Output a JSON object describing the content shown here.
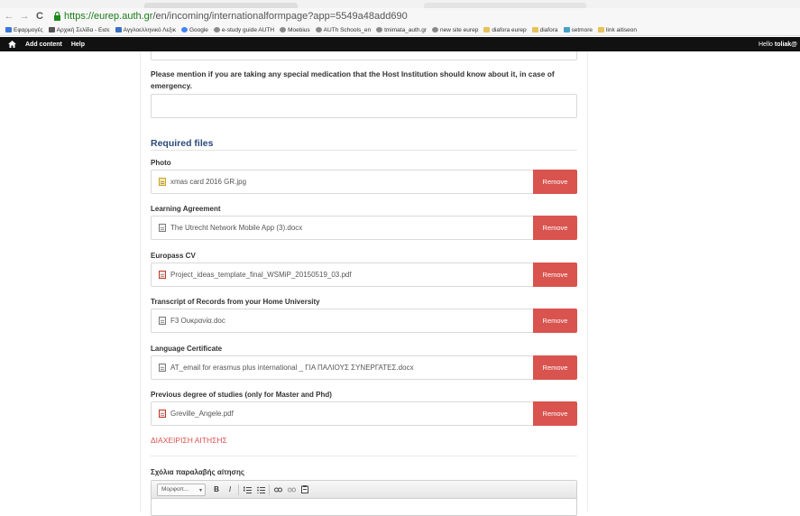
{
  "browser": {
    "url_host": "https://eurep.auth.gr",
    "url_path": "/en/incoming/internationalformpage?app=5549a48add690",
    "bookmarks": [
      {
        "label": "Εφαρμογές",
        "icon": "grid"
      },
      {
        "label": "Αρχική Σελίδα - Εισε",
        "icon": "mail"
      },
      {
        "label": "Αγγλοελληνικό Λεξικ",
        "icon": "blue"
      },
      {
        "label": "Google",
        "icon": "g"
      },
      {
        "label": "e-study guide AUTH",
        "icon": "globe"
      },
      {
        "label": "Moebius",
        "icon": "globe"
      },
      {
        "label": "AUTh Schools_en",
        "icon": "globe"
      },
      {
        "label": "tmimata_auth.gr",
        "icon": "globe"
      },
      {
        "label": "new site eurep",
        "icon": "globe"
      },
      {
        "label": "diafora eurep",
        "icon": "folder"
      },
      {
        "label": "diafora",
        "icon": "folder"
      },
      {
        "label": "setmore",
        "icon": "teal"
      },
      {
        "label": "link aitiseon",
        "icon": "folder"
      }
    ]
  },
  "adminbar": {
    "add_content": "Add content",
    "help": "Help",
    "hello_prefix": "Hello ",
    "username": "toliak@"
  },
  "form": {
    "medication_question": "Please mention if you are taking any special medication that the Host Institution should know about it, in case of emergency.",
    "required_files_title": "Required files",
    "remove_label": "Remove",
    "files": [
      {
        "label": "Photo",
        "filename": "xmas card 2016 GR.jpg",
        "type": "img"
      },
      {
        "label": "Learning Agreement",
        "filename": "The Utrecht Network Mobile App (3).docx",
        "type": "doc"
      },
      {
        "label": "Europass CV",
        "filename": "Project_ideas_template_final_WSMiP_20150519_03.pdf",
        "type": "pdf"
      },
      {
        "label": "Transcript of Records from your Home University",
        "filename": "F3 Ουκρανία.doc",
        "type": "doc"
      },
      {
        "label": "Language Certificate",
        "filename": "AT_email for erasmus plus international _ ΓΙΑ ΠΑΛΙΟΥΣ ΣΥΝΕΡΓΑΤΕΣ.docx",
        "type": "doc"
      },
      {
        "label": "Previous degree of studies (only for Master and Phd)",
        "filename": "Greville_Angele.pdf",
        "type": "pdf"
      }
    ],
    "manage_link": "ΔΙΑΧΕΙΡΙΣΗ ΑΙΤΗΣΗΣ",
    "comments_label": "Σχόλια παραλαβής αίτησης",
    "editor": {
      "format_value": "Μορφοπ...",
      "bold": "B",
      "italic": "I"
    }
  }
}
